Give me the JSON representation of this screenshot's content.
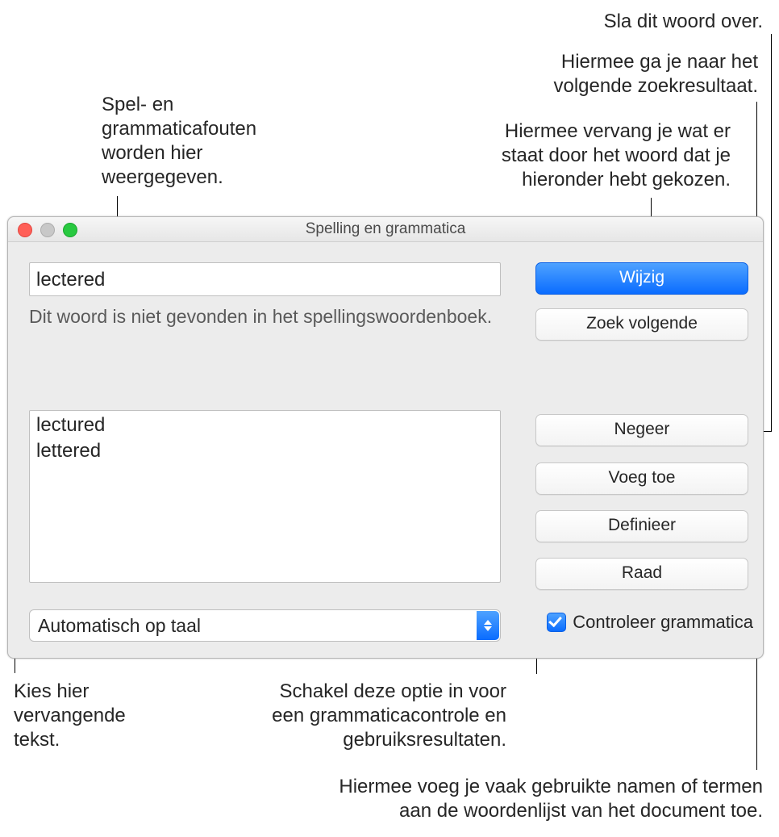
{
  "callouts": {
    "skip": "Sla dit woord over.",
    "next": "Hiermee ga je naar het\nvolgende zoekresultaat.",
    "errors_shown": "Spel- en\ngrammaticafouten\nworden hier\nweergegeven.",
    "change": "Hiermee vervang je wat er\nstaat door het woord dat je\nhieronder hebt gekozen.",
    "pick_replacement": "Kies hier\nvervangende\ntekst.",
    "enable_grammar": "Schakel deze optie in voor\neen grammaticacontrole en\ngebruiksresultaten.",
    "add_word": "Hiermee voeg je vaak gebruikte namen of termen\naan de woordenlijst van het document toe."
  },
  "dialog": {
    "title": "Spelling en grammatica",
    "misspelled_word": "lectered",
    "status_text": "Dit woord is niet gevonden in het spellingswoordenboek.",
    "suggestions": [
      "lectured",
      "lettered"
    ],
    "buttons": {
      "change": "Wijzig",
      "find_next": "Zoek volgende",
      "ignore": "Negeer",
      "add": "Voeg toe",
      "define": "Definieer",
      "guess": "Raad"
    },
    "language_select": "Automatisch op taal",
    "check_grammar_label": "Controleer grammatica",
    "check_grammar_checked": true
  }
}
